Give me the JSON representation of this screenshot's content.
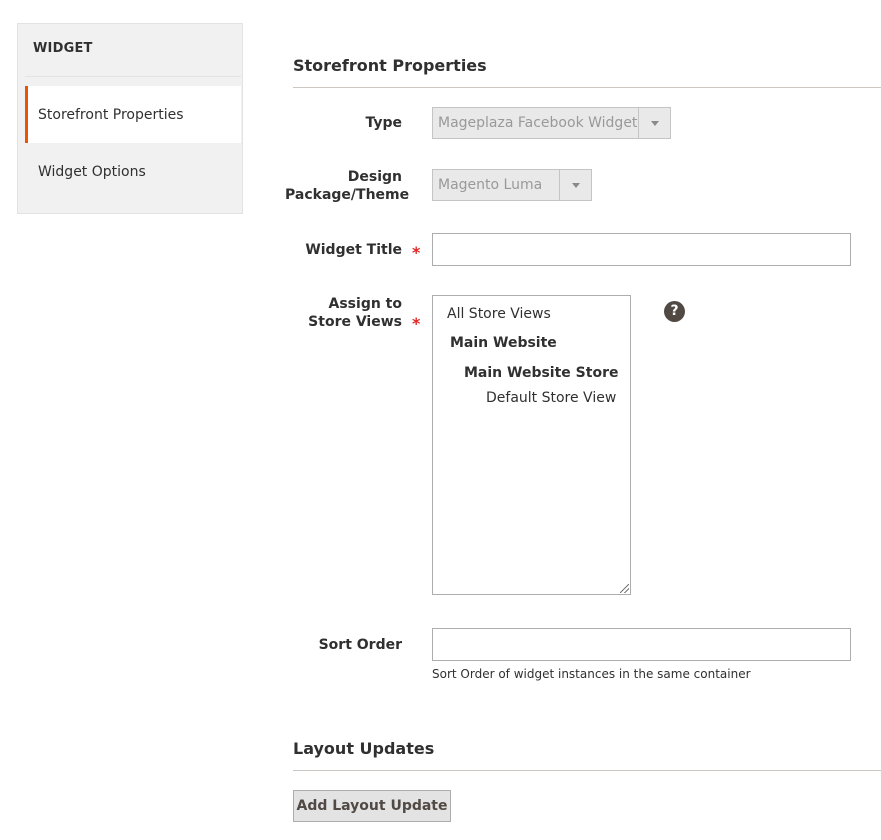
{
  "sidebar": {
    "title": "WIDGET",
    "items": [
      {
        "label": "Storefront Properties",
        "active": true
      },
      {
        "label": "Widget Options",
        "active": false
      }
    ]
  },
  "storefront": {
    "heading": "Storefront Properties",
    "type": {
      "label": "Type",
      "value": "Mageplaza Facebook Widget"
    },
    "theme": {
      "label": "Design Package/Theme",
      "value": "Magento Luma"
    },
    "title": {
      "label": "Widget Title",
      "value": "",
      "required_mark": "*"
    },
    "store_views": {
      "label": "Assign to Store Views",
      "required_mark": "*",
      "help_icon": "?",
      "options": [
        "All Store Views",
        "Main Website",
        "Main Website Store",
        "Default Store View"
      ]
    },
    "sort_order": {
      "label": "Sort Order",
      "value": "",
      "note": "Sort Order of widget instances in the same container"
    }
  },
  "layout": {
    "heading": "Layout Updates",
    "add_button": "Add Layout Update"
  },
  "colors": {
    "accent": "#eb5202",
    "required": "#e22626",
    "help_icon_bg": "#514943"
  }
}
